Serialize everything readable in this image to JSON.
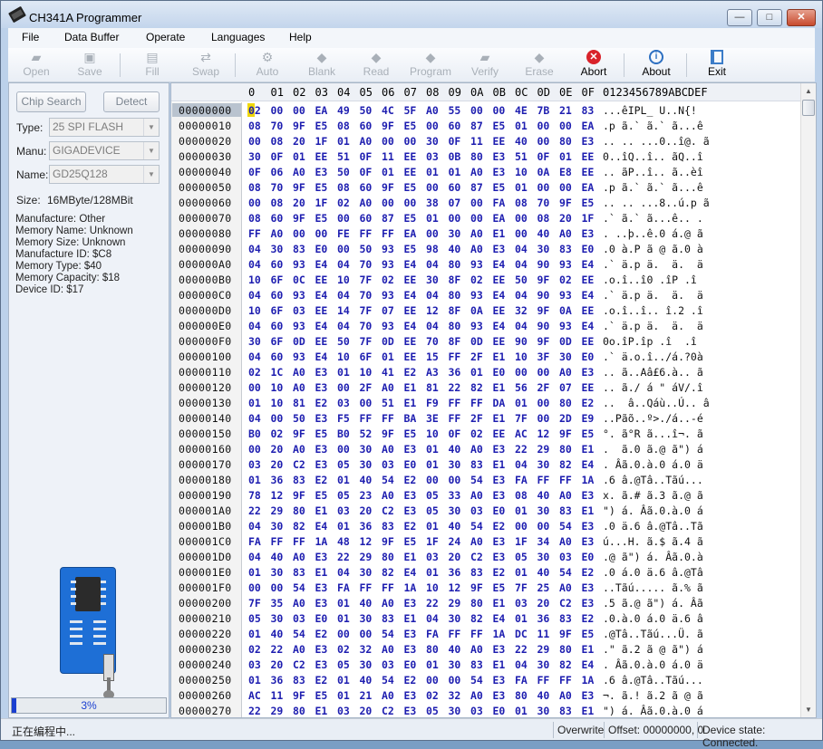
{
  "window": {
    "title": "CH341A Programmer",
    "min": "—",
    "max": "□",
    "close": "✕"
  },
  "menu": [
    "File",
    "Data Buffer",
    "Operate",
    "Languages",
    "Help"
  ],
  "toolbar": [
    {
      "label": "Open",
      "icon": "folder-icon",
      "enabled": false
    },
    {
      "label": "Save",
      "icon": "save-icon",
      "enabled": false
    },
    {
      "label": "Fill",
      "icon": "fill-icon",
      "enabled": false
    },
    {
      "label": "Swap",
      "icon": "swap-icon",
      "enabled": false
    },
    {
      "label": "Auto",
      "icon": "auto-icon",
      "enabled": false
    },
    {
      "label": "Blank",
      "icon": "blank-icon",
      "enabled": false
    },
    {
      "label": "Read",
      "icon": "read-icon",
      "enabled": false
    },
    {
      "label": "Program",
      "icon": "program-icon",
      "enabled": false
    },
    {
      "label": "Verify",
      "icon": "verify-icon",
      "enabled": false
    },
    {
      "label": "Erase",
      "icon": "erase-icon",
      "enabled": false
    },
    {
      "label": "Abort",
      "icon": "abort-icon",
      "enabled": true
    },
    {
      "label": "About",
      "icon": "info-icon",
      "enabled": true
    },
    {
      "label": "Exit",
      "icon": "exit-icon",
      "enabled": true
    }
  ],
  "left": {
    "chip_search": "Chip Search",
    "detect": "Detect",
    "type_label": "Type:",
    "type_value": "25 SPI FLASH",
    "manu_label": "Manu:",
    "manu_value": "GIGADEVICE",
    "name_label": "Name:",
    "name_value": "GD25Q128",
    "size_label": "Size:",
    "size_value": "16MByte/128MBit",
    "info": [
      "Manufacture: Other",
      "Memory Name: Unknown",
      "Memory Size: Unknown",
      "Manufacture ID: $C8",
      "Memory Type: $40",
      "Memory Capacity: $18",
      "Device ID: $17"
    ],
    "progress_text": "3%",
    "progress_value": 0.03
  },
  "hex": {
    "columns": [
      "0",
      "01",
      "02",
      "03",
      "04",
      "05",
      "06",
      "07",
      "08",
      "09",
      "0A",
      "0B",
      "0C",
      "0D",
      "0E",
      "0F"
    ],
    "ascii_header": "0123456789ABCDEF",
    "rows": [
      {
        "addr": "00000000",
        "bytes": "02 00 00 EA 49 50 4C 5F A0 55 00 00 4E 7B 21 83",
        "ascii": "...êIPL_ U..N{!"
      },
      {
        "addr": "00000010",
        "bytes": "08 70 9F E5 08 60 9F E5 00 60 87 E5 01 00 00 EA",
        "ascii": ".p ã.` ã.` ã...ê"
      },
      {
        "addr": "00000020",
        "bytes": "00 08 20 1F 01 A0 00 00 30 0F 11 EE 40 00 80 E3",
        "ascii": ".. .. ...0..î@. ã"
      },
      {
        "addr": "00000030",
        "bytes": "30 0F 01 EE 51 0F 11 EE 03 0B 80 E3 51 0F 01 EE",
        "ascii": "0..îQ..î.. ãQ..î"
      },
      {
        "addr": "00000040",
        "bytes": "0F 06 A0 E3 50 0F 01 EE 01 01 A0 E3 10 0A E8 EE",
        "ascii": ".. ãP..î.. ã..èî"
      },
      {
        "addr": "00000050",
        "bytes": "08 70 9F E5 08 60 9F E5 00 60 87 E5 01 00 00 EA",
        "ascii": ".p ã.` ã.` ã...ê"
      },
      {
        "addr": "00000060",
        "bytes": "00 08 20 1F 02 A0 00 00 38 07 00 FA 08 70 9F E5",
        "ascii": ".. .. ...8..ú.p ã"
      },
      {
        "addr": "00000070",
        "bytes": "08 60 9F E5 00 60 87 E5 01 00 00 EA 00 08 20 1F",
        "ascii": ".` ã.` ã...ê.. ."
      },
      {
        "addr": "00000080",
        "bytes": "FF A0 00 00 FE FF FF EA 00 30 A0 E1 00 40 A0 E3",
        "ascii": ". ..þ..ê.0 á.@ ã"
      },
      {
        "addr": "00000090",
        "bytes": "04 30 83 E0 00 50 93 E5 98 40 A0 E3 04 30 83 E0",
        "ascii": ".0 à.P ã @ ã.0 à"
      },
      {
        "addr": "000000A0",
        "bytes": "04 60 93 E4 04 70 93 E4 04 80 93 E4 04 90 93 E4",
        "ascii": ".` ä.p ä.  ä.  ä"
      },
      {
        "addr": "000000B0",
        "bytes": "10 6F 0C EE 10 7F 02 EE 30 8F 02 EE 50 9F 02 EE",
        "ascii": ".o.î..î0 .îP .î"
      },
      {
        "addr": "000000C0",
        "bytes": "04 60 93 E4 04 70 93 E4 04 80 93 E4 04 90 93 E4",
        "ascii": ".` ä.p ä.  ä.  ä"
      },
      {
        "addr": "000000D0",
        "bytes": "10 6F 03 EE 14 7F 07 EE 12 8F 0A EE 32 9F 0A EE",
        "ascii": ".o.î..î.. î.2 .î"
      },
      {
        "addr": "000000E0",
        "bytes": "04 60 93 E4 04 70 93 E4 04 80 93 E4 04 90 93 E4",
        "ascii": ".` ä.p ä.  ä.  ä"
      },
      {
        "addr": "000000F0",
        "bytes": "30 6F 0D EE 50 7F 0D EE 70 8F 0D EE 90 9F 0D EE",
        "ascii": "0o.îP.îp .î  .î"
      },
      {
        "addr": "00000100",
        "bytes": "04 60 93 E4 10 6F 01 EE 15 FF 2F E1 10 3F 30 E0",
        "ascii": ".` ä.o.î../á.?0à"
      },
      {
        "addr": "00000110",
        "bytes": "02 1C A0 E3 01 10 41 E2 A3 36 01 E0 00 00 A0 E3",
        "ascii": ".. ã..Aâ£6.à.. ã"
      },
      {
        "addr": "00000120",
        "bytes": "00 10 A0 E3 00 2F A0 E1 81 22 82 E1 56 2F 07 EE",
        "ascii": ".. ã./ á \" áV/.î"
      },
      {
        "addr": "00000130",
        "bytes": "01 10 81 E2 03 00 51 E1 F9 FF FF DA 01 00 80 E2",
        "ascii": "..  â..Qáù..Ú.. â"
      },
      {
        "addr": "00000140",
        "bytes": "04 00 50 E3 F5 FF FF BA 3E FF 2F E1 7F 00 2D E9",
        "ascii": "..Pãõ..º>./á..-é"
      },
      {
        "addr": "00000150",
        "bytes": "B0 02 9F E5 B0 52 9F E5 10 0F 02 EE AC 12 9F E5",
        "ascii": "°. ã°R ã...î¬. ã"
      },
      {
        "addr": "00000160",
        "bytes": "00 20 A0 E3 00 30 A0 E3 01 40 A0 E3 22 29 80 E1",
        "ascii": ".  ã.0 ã.@ ã\") á"
      },
      {
        "addr": "00000170",
        "bytes": "03 20 C2 E3 05 30 03 E0 01 30 83 E1 04 30 82 E4",
        "ascii": ". Âã.0.à.0 á.0 ä"
      },
      {
        "addr": "00000180",
        "bytes": "01 36 83 E2 01 40 54 E2 00 00 54 E3 FA FF FF 1A",
        "ascii": ".6 â.@Tâ..Tãú..."
      },
      {
        "addr": "00000190",
        "bytes": "78 12 9F E5 05 23 A0 E3 05 33 A0 E3 08 40 A0 E3",
        "ascii": "x. ã.# ã.3 ã.@ ã"
      },
      {
        "addr": "000001A0",
        "bytes": "22 29 80 E1 03 20 C2 E3 05 30 03 E0 01 30 83 E1",
        "ascii": "\") á. Âã.0.à.0 á"
      },
      {
        "addr": "000001B0",
        "bytes": "04 30 82 E4 01 36 83 E2 01 40 54 E2 00 00 54 E3",
        "ascii": ".0 ä.6 â.@Tâ..Tã"
      },
      {
        "addr": "000001C0",
        "bytes": "FA FF FF 1A 48 12 9F E5 1F 24 A0 E3 1F 34 A0 E3",
        "ascii": "ú...H. ã.$ ã.4 ã"
      },
      {
        "addr": "000001D0",
        "bytes": "04 40 A0 E3 22 29 80 E1 03 20 C2 E3 05 30 03 E0",
        "ascii": ".@ ã\") á. Âã.0.à"
      },
      {
        "addr": "000001E0",
        "bytes": "01 30 83 E1 04 30 82 E4 01 36 83 E2 01 40 54 E2",
        "ascii": ".0 á.0 ä.6 â.@Tâ"
      },
      {
        "addr": "000001F0",
        "bytes": "00 00 54 E3 FA FF FF 1A 10 12 9F E5 7F 25 A0 E3",
        "ascii": "..Tãú..... ã.% ã"
      },
      {
        "addr": "00000200",
        "bytes": "7F 35 A0 E3 01 40 A0 E3 22 29 80 E1 03 20 C2 E3",
        "ascii": ".5 ã.@ ã\") á. Âã"
      },
      {
        "addr": "00000210",
        "bytes": "05 30 03 E0 01 30 83 E1 04 30 82 E4 01 36 83 E2",
        "ascii": ".0.à.0 á.0 ä.6 â"
      },
      {
        "addr": "00000220",
        "bytes": "01 40 54 E2 00 00 54 E3 FA FF FF 1A DC 11 9F E5",
        "ascii": ".@Tâ..Tãú...Ü. ã"
      },
      {
        "addr": "00000230",
        "bytes": "02 22 A0 E3 02 32 A0 E3 80 40 A0 E3 22 29 80 E1",
        "ascii": ".\" ã.2 ã @ ã\") á"
      },
      {
        "addr": "00000240",
        "bytes": "03 20 C2 E3 05 30 03 E0 01 30 83 E1 04 30 82 E4",
        "ascii": ". Âã.0.à.0 á.0 ä"
      },
      {
        "addr": "00000250",
        "bytes": "01 36 83 E2 01 40 54 E2 00 00 54 E3 FA FF FF 1A",
        "ascii": ".6 â.@Tâ..Tãú..."
      },
      {
        "addr": "00000260",
        "bytes": "AC 11 9F E5 01 21 A0 E3 02 32 A0 E3 80 40 A0 E3",
        "ascii": "¬. ã.! ã.2 ã @ ã"
      },
      {
        "addr": "00000270",
        "bytes": "22 29 80 E1 03 20 C2 E3 05 30 03 E0 01 30 83 E1",
        "ascii": "\") á. Âã.0.à.0 á"
      }
    ]
  },
  "status": {
    "message": "正在编程中...",
    "mode": "Overwrite",
    "offset": "Offset: 00000000, 0",
    "device_state": "Device state: Connected."
  }
}
